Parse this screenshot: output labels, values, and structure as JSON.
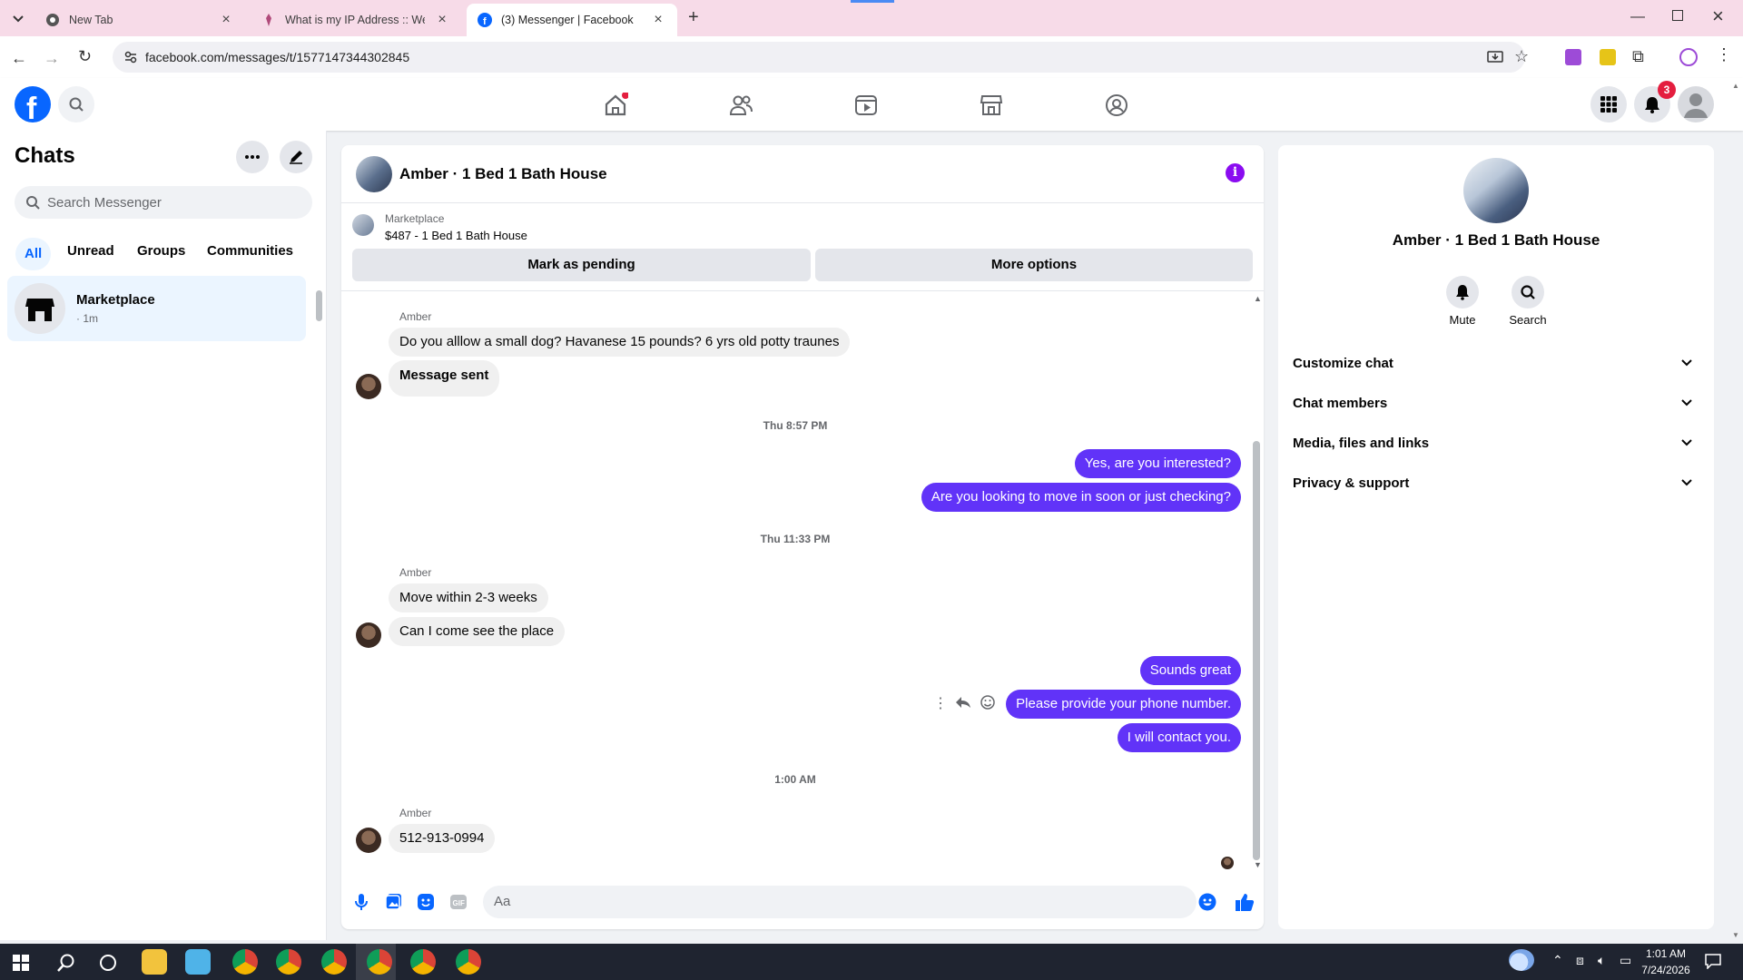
{
  "browser": {
    "tabs": [
      {
        "title": "New Tab",
        "icon": "chrome-icon"
      },
      {
        "title": "What is my IP Address :: WebBr",
        "icon": "pin-icon"
      },
      {
        "title": "(3) Messenger | Facebook",
        "icon": "facebook-icon"
      }
    ],
    "url": "facebook.com/messages/t/1577147344302845"
  },
  "header": {
    "notifications_count": "3"
  },
  "sidebar": {
    "title": "Chats",
    "search_placeholder": "Search Messenger",
    "filters": [
      "All",
      "Unread",
      "Groups",
      "Communities"
    ],
    "chat": {
      "name": "Marketplace",
      "time": "· 1m"
    }
  },
  "conversation": {
    "title": "Amber · 1 Bed 1 Bath House",
    "listing_label": "Marketplace",
    "listing_title": "$487 - 1 Bed 1 Bath House",
    "mark_pending": "Mark as pending",
    "more_options": "More options",
    "sender_name": "Amber",
    "messages": {
      "m1": "Do you alllow a small dog? Havanese 15 pounds? 6 yrs old potty traunes",
      "m2": "Message sent",
      "t1": "Thu 8:57 PM",
      "m3": "Yes, are you interested?",
      "m4": "Are you looking to move in soon or just checking?",
      "t2": "Thu 11:33 PM",
      "m5": "Move within 2-3 weeks",
      "m6": "Can I come see the place",
      "m7": "Sounds great",
      "m8": "Please provide your phone number.",
      "m9": "I will contact you.",
      "t3": "1:00 AM",
      "m10": "512-913-0994"
    },
    "composer_placeholder": "Aa"
  },
  "details": {
    "name": "Amber · 1 Bed 1 Bath House",
    "mute": "Mute",
    "search": "Search",
    "sections": [
      "Customize chat",
      "Chat members",
      "Media, files and links",
      "Privacy & support"
    ]
  },
  "taskbar": {
    "time": "1:01 AM",
    "date": "7/24/2026"
  },
  "colors": {
    "accent": "#0866ff",
    "outgoing": "#6133f8",
    "info": "#8a0cf0",
    "badge": "#e41e3f"
  }
}
